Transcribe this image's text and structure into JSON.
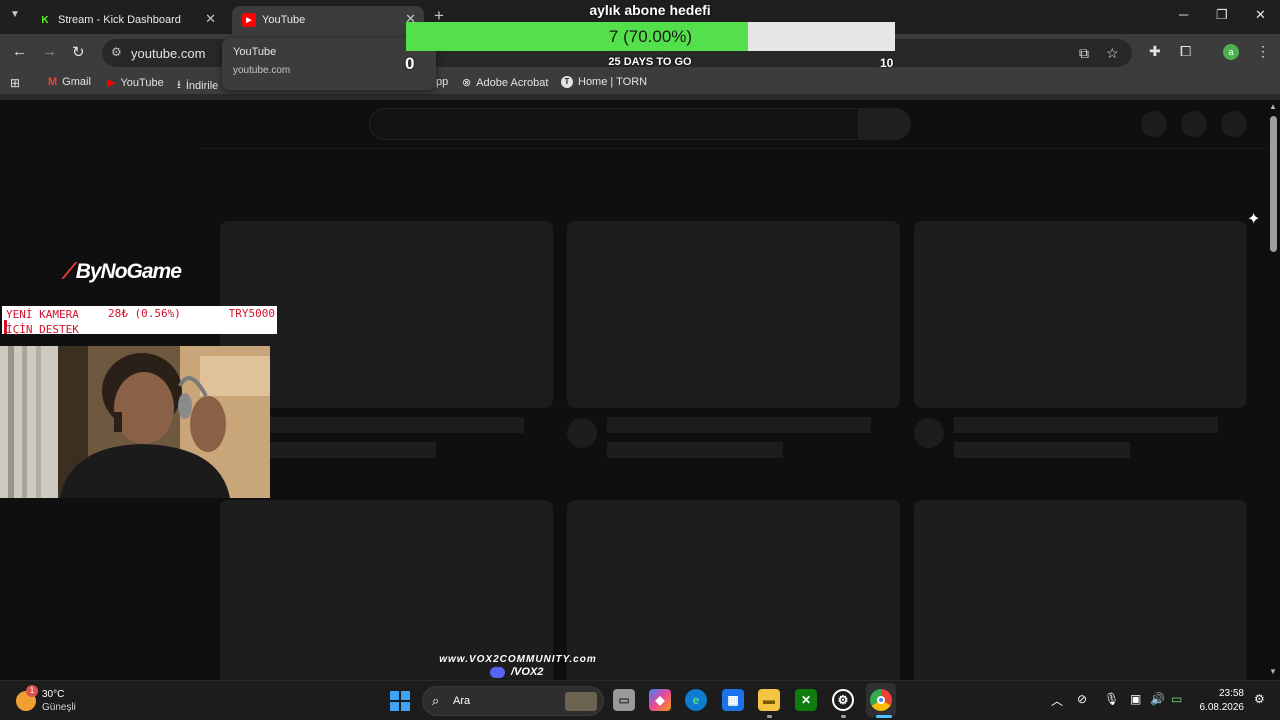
{
  "browser": {
    "tabs": [
      {
        "label": "Stream - Kick Dashboard",
        "icon": "kick-icon",
        "active": false
      },
      {
        "label": "YouTube",
        "icon": "youtube-icon",
        "active": true
      }
    ],
    "new_tab_label": "+",
    "url": "youtube.com",
    "hover_card": {
      "title": "YouTube",
      "url": "youtube.com"
    },
    "bookmarks": [
      {
        "label": "Gmail",
        "icon": "gmail-icon"
      },
      {
        "label": "YouTube",
        "icon": "youtube-icon"
      },
      {
        "label": "İndirile",
        "icon": "download-icon"
      },
      {
        "label": "pp",
        "icon": ""
      },
      {
        "label": "Adobe Acrobat",
        "icon": "acrobat-icon"
      },
      {
        "label": "Home | TORN",
        "icon": "torn-icon"
      }
    ],
    "profile_initial": "a",
    "colors": {
      "frame": "#1f1f1f",
      "toolbar": "#3c3c3c",
      "page": "#0f0f0f"
    }
  },
  "subscriber_goal": {
    "title": "aylık abone hedefi",
    "progress_text": "7 (70.00%)",
    "current": 7,
    "percent": 70,
    "min": "0",
    "max": "10",
    "days_left": "25 DAYS TO GO",
    "colors": {
      "fill": "#53e04a",
      "track": "#e6e6e6"
    }
  },
  "stream_overlay": {
    "brand": "ByNoGame",
    "donation_goal": {
      "title": "YENİ KAMERA İÇİN DESTEK",
      "amount": "28₺ (0.56%)",
      "target": "TRY5000",
      "percent": 0.56
    },
    "community_url": "www.VOX2COMMUNITY.com",
    "community_handle": "/VOX2"
  },
  "taskbar": {
    "weather": {
      "temp": "30°C",
      "desc": "Güneşli",
      "badge": "1"
    },
    "search_label": "Ara",
    "clock": {
      "time": "23:58",
      "date": "6.08.2026"
    }
  }
}
